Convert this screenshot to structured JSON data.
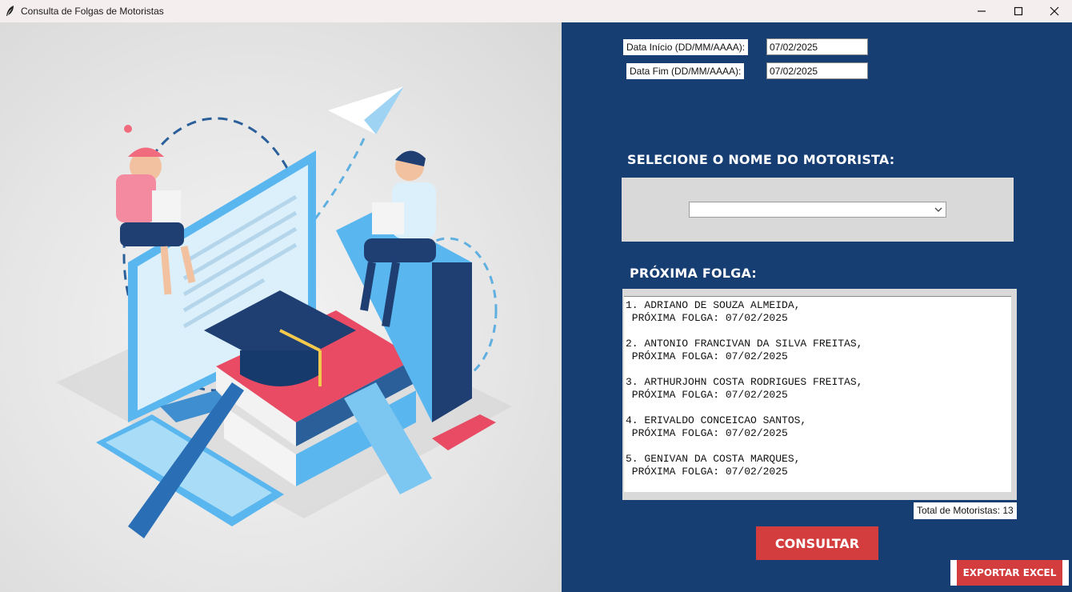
{
  "window": {
    "title": "Consulta de Folgas de Motoristas"
  },
  "form": {
    "start_label": "Data Início (DD/MM/AAAA):",
    "start_value": "07/02/2025",
    "end_label": "Data Fim (DD/MM/AAAA):",
    "end_value": "07/02/2025"
  },
  "driver_select": {
    "title": "SELECIONE O NOME DO MOTORISTA:",
    "selected": ""
  },
  "next_off": {
    "title": "PRÓXIMA FOLGA:",
    "entries": [
      {
        "name": "1. ADRIANO DE SOUZA ALMEIDA,",
        "date": " PRÓXIMA FOLGA: 07/02/2025"
      },
      {
        "name": "2. ANTONIO FRANCIVAN DA SILVA FREITAS,",
        "date": " PRÓXIMA FOLGA: 07/02/2025"
      },
      {
        "name": "3. ARTHURJOHN COSTA RODRIGUES FREITAS,",
        "date": " PRÓXIMA FOLGA: 07/02/2025"
      },
      {
        "name": "4. ERIVALDO CONCEICAO SANTOS,",
        "date": " PRÓXIMA FOLGA: 07/02/2025"
      },
      {
        "name": "5. GENIVAN DA COSTA MARQUES,",
        "date": " PRÓXIMA FOLGA: 07/02/2025"
      }
    ]
  },
  "total_label": "Total de Motoristas: 13",
  "buttons": {
    "consultar": "CONSULTAR",
    "exportar": "EXPORTAR EXCEL"
  },
  "colors": {
    "panel_bg": "#163e73",
    "button_red": "#d43d3d",
    "frame_gray": "#d9d9d9"
  },
  "icons": {
    "app": "feather-icon",
    "minimize": "minimize-icon",
    "maximize": "maximize-icon",
    "close": "close-icon",
    "dropdown": "chevron-down-icon"
  }
}
